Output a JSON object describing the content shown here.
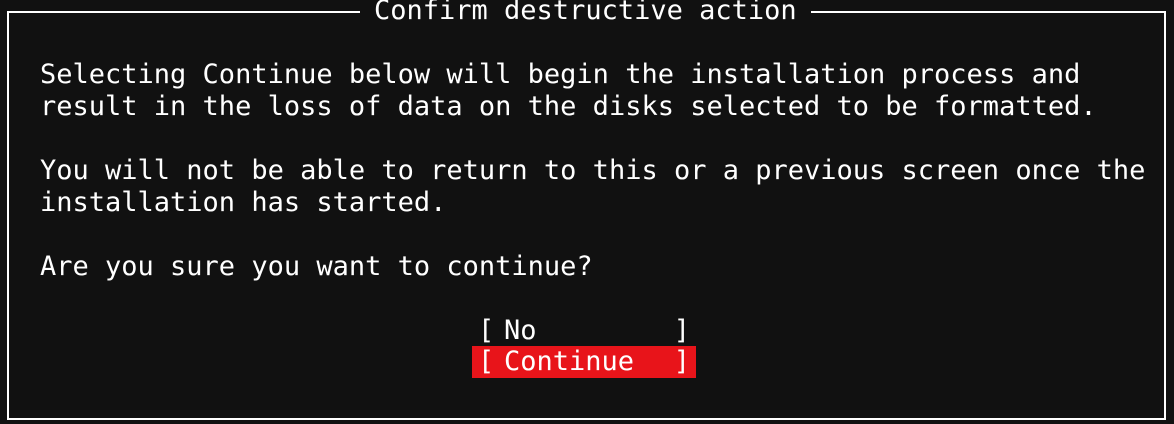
{
  "dialog": {
    "title": "Confirm destructive action",
    "lines": [
      "Selecting Continue below will begin the installation process and",
      "result in the loss of data on the disks selected to be formatted.",
      "You will not be able to return to this or a previous screen once the",
      "installation has started.",
      "Are you sure you want to continue?"
    ],
    "buttons": [
      {
        "label": "No",
        "selected": false
      },
      {
        "label": "Continue",
        "selected": true
      }
    ],
    "bracket_open": "[",
    "bracket_close": "]"
  },
  "colors": {
    "background": "#111111",
    "text": "#ffffff",
    "selected_button": "#e8141a"
  }
}
